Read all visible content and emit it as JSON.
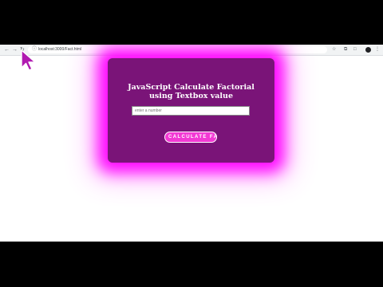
{
  "browser": {
    "nav": {
      "back": "←",
      "forward": "→",
      "reload": "↻"
    },
    "url_icon": "ⓘ",
    "url": "localhost:3000/Fact.html",
    "toolbar_icons": {
      "star": "☆",
      "extension": "⧉",
      "split": "□"
    },
    "menu": "⋮"
  },
  "main": {
    "title": "JavaScript Calculate Factorial using Textbox value",
    "input_placeholder": "enter a number",
    "input_value": "",
    "button_label": "CALCULATE FA"
  },
  "colors": {
    "card": "#7a1478",
    "glow": "#ff00ff",
    "button": "#f339d4",
    "cursor": "#b01ab0"
  }
}
